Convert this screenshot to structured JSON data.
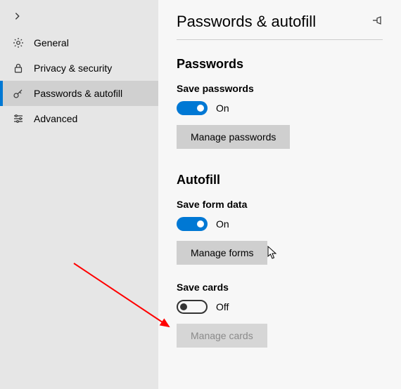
{
  "header": {
    "title": "Passwords & autofill"
  },
  "sidebar": {
    "items": [
      {
        "label": "General"
      },
      {
        "label": "Privacy & security"
      },
      {
        "label": "Passwords & autofill"
      },
      {
        "label": "Advanced"
      }
    ]
  },
  "sections": {
    "passwords": {
      "title": "Passwords",
      "save_label": "Save passwords",
      "toggle_state": "On",
      "manage_button": "Manage passwords"
    },
    "autofill": {
      "title": "Autofill",
      "save_forms_label": "Save form data",
      "forms_toggle_state": "On",
      "manage_forms_button": "Manage forms",
      "save_cards_label": "Save cards",
      "cards_toggle_state": "Off",
      "manage_cards_button": "Manage cards"
    }
  },
  "colors": {
    "accent": "#0078d4",
    "button_bg": "#cfcfcf",
    "sidebar_bg": "#e6e6e6"
  }
}
